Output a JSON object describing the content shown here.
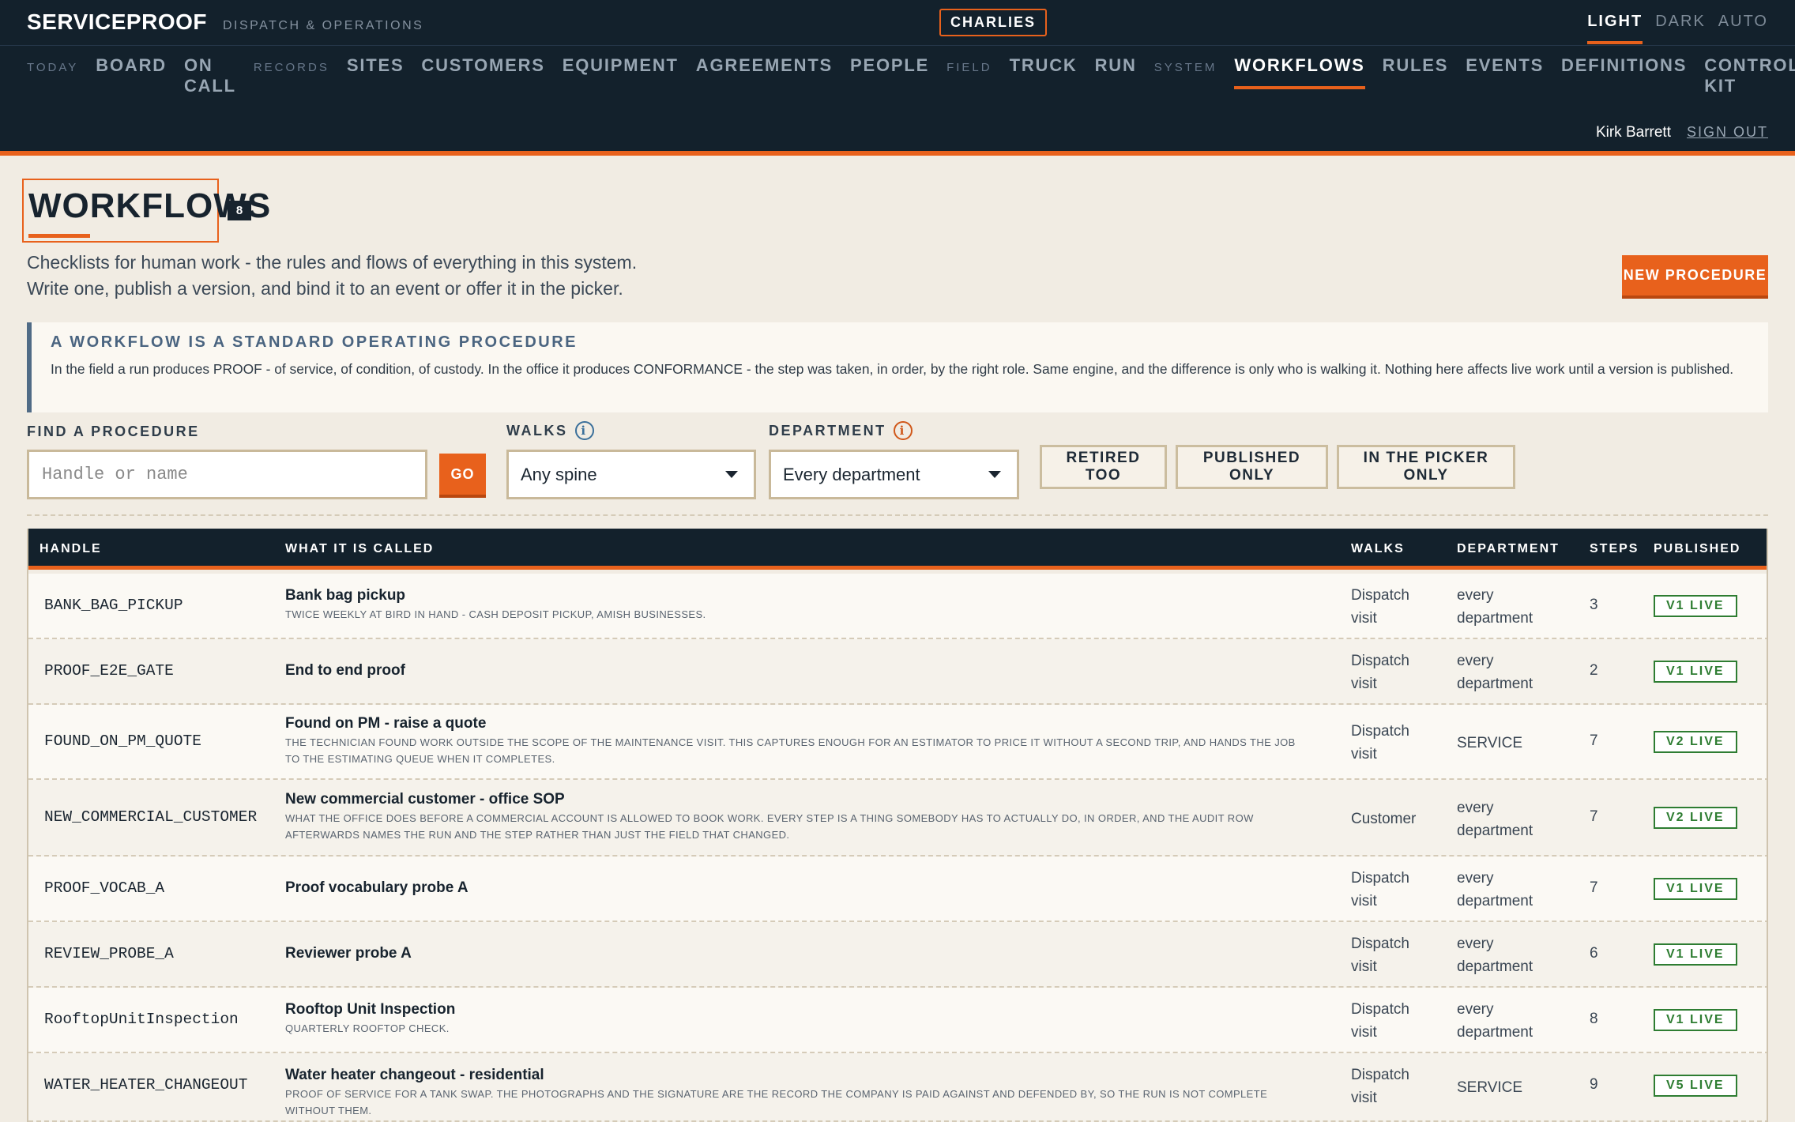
{
  "app": {
    "brand": "SERVICEPROOF",
    "subtitle": "DISPATCH & OPERATIONS",
    "tenant": "CHARLIES"
  },
  "theme": {
    "options": [
      "LIGHT",
      "DARK",
      "AUTO"
    ],
    "selected": "LIGHT"
  },
  "nav": {
    "groups": [
      {
        "label": "TODAY",
        "items": [
          "BOARD",
          "ON CALL"
        ]
      },
      {
        "label": "RECORDS",
        "items": [
          "SITES",
          "CUSTOMERS",
          "EQUIPMENT",
          "AGREEMENTS",
          "PEOPLE"
        ]
      },
      {
        "label": "FIELD",
        "items": [
          "TRUCK",
          "RUN"
        ]
      },
      {
        "label": "SYSTEM",
        "items": [
          "WORKFLOWS",
          "RULES",
          "EVENTS",
          "DEFINITIONS",
          "CONTROL KIT"
        ]
      }
    ],
    "active": "WORKFLOWS"
  },
  "user": {
    "name": "Kirk Barrett",
    "sign_out": "SIGN OUT"
  },
  "page": {
    "title": "WORKFLOWS",
    "count": "8",
    "intro_line1": "Checklists for human work - the rules and flows of everything in this system.",
    "intro_line2": "Write one, publish a version, and bind it to an event or offer it in the picker.",
    "new_button": "NEW PROCEDURE"
  },
  "callout": {
    "title": "A WORKFLOW IS A STANDARD OPERATING PROCEDURE",
    "body": "In the field a run produces PROOF - of service, of condition, of custody. In the office it produces CONFORMANCE - the step was taken, in order, by the right role. Same engine, and the difference is only who is walking it. Nothing here affects live work until a version is published."
  },
  "filters": {
    "find_label": "FIND A PROCEDURE",
    "search_placeholder": "Handle or name",
    "go": "GO",
    "walks_label": "WALKS",
    "walks_value": "Any spine",
    "department_label": "DEPARTMENT",
    "department_value": "Every department",
    "toggles": [
      "RETIRED TOO",
      "PUBLISHED ONLY",
      "IN THE PICKER ONLY"
    ]
  },
  "table": {
    "headers": [
      "HANDLE",
      "WHAT IT IS CALLED",
      "WALKS",
      "DEPARTMENT",
      "STEPS",
      "PUBLISHED"
    ],
    "rows": [
      {
        "handle": "BANK_BAG_PICKUP",
        "name": "Bank bag pickup",
        "desc": "Twice weekly at Bird in Hand - cash deposit pickup, Amish businesses.",
        "walks1": "Dispatch",
        "walks2": "visit",
        "dept1": "every",
        "dept2": "department",
        "steps": "3",
        "published": "V1 LIVE"
      },
      {
        "handle": "PROOF_E2E_GATE",
        "name": "End to end proof",
        "desc": "",
        "walks1": "Dispatch",
        "walks2": "visit",
        "dept1": "every",
        "dept2": "department",
        "steps": "2",
        "published": "V1 LIVE"
      },
      {
        "handle": "FOUND_ON_PM_QUOTE",
        "name": "Found on PM - raise a quote",
        "desc": "The technician found work outside the scope of the maintenance visit. This captures enough for an estimator to price it without a second trip, and hands the job to the estimating queue when it completes.",
        "walks1": "Dispatch",
        "walks2": "visit",
        "dept1": "SERVICE",
        "dept2": "",
        "steps": "7",
        "published": "V2 LIVE"
      },
      {
        "handle": "NEW_COMMERCIAL_CUSTOMER",
        "name": "New commercial customer - office SOP",
        "desc": "What the office does before a commercial account is allowed to book work. Every step is a thing somebody has to actually do, in order, and the audit row afterwards names the run and the step rather than just the field that changed.",
        "walks1": "Customer",
        "walks2": "",
        "dept1": "every",
        "dept2": "department",
        "steps": "7",
        "published": "V2 LIVE"
      },
      {
        "handle": "PROOF_VOCAB_A",
        "name": "Proof vocabulary probe A",
        "desc": "",
        "walks1": "Dispatch",
        "walks2": "visit",
        "dept1": "every",
        "dept2": "department",
        "steps": "7",
        "published": "V1 LIVE"
      },
      {
        "handle": "REVIEW_PROBE_A",
        "name": "Reviewer probe A",
        "desc": "",
        "walks1": "Dispatch",
        "walks2": "visit",
        "dept1": "every",
        "dept2": "department",
        "steps": "6",
        "published": "V1 LIVE"
      },
      {
        "handle": "RooftopUnitInspection",
        "name": "Rooftop Unit Inspection",
        "desc": "Quarterly rooftop check.",
        "walks1": "Dispatch",
        "walks2": "visit",
        "dept1": "every",
        "dept2": "department",
        "steps": "8",
        "published": "V1 LIVE"
      },
      {
        "handle": "WATER_HEATER_CHANGEOUT",
        "name": "Water heater changeout - residential",
        "desc": "Proof of service for a tank swap. The photographs and the signature are the record the company is paid against and defended by, so the run is not complete without them.",
        "walks1": "Dispatch",
        "walks2": "visit",
        "dept1": "SERVICE",
        "dept2": "",
        "steps": "9",
        "published": "V5 LIVE"
      }
    ]
  }
}
